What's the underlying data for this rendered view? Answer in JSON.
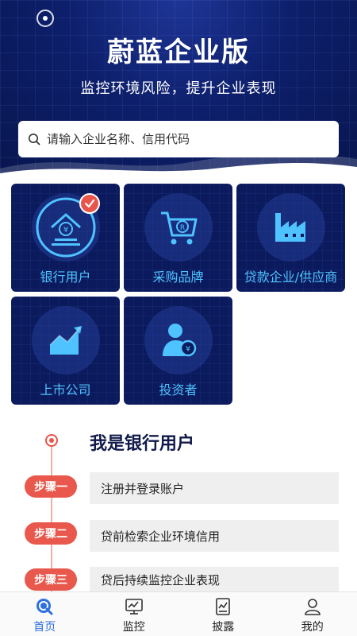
{
  "header": {
    "title": "蔚蓝企业版",
    "subtitle": "监控环境风险，提升企业表现"
  },
  "search": {
    "placeholder": "请输入企业名称、信用代码",
    "icon": "search-icon"
  },
  "categories": [
    {
      "label": "银行用户",
      "icon": "bank-icon",
      "selected": true
    },
    {
      "label": "采购品牌",
      "icon": "shopping-cart-icon",
      "selected": false
    },
    {
      "label": "贷款企业/供应商",
      "icon": "factory-icon",
      "selected": false
    },
    {
      "label": "上市公司",
      "icon": "stock-chart-icon",
      "selected": false
    },
    {
      "label": "投资者",
      "icon": "investor-icon",
      "selected": false
    }
  ],
  "steps": {
    "title": "我是银行用户",
    "items": [
      {
        "badge": "步骤一",
        "text": "注册并登录账户"
      },
      {
        "badge": "步骤二",
        "text": "贷前检索企业环境信用"
      },
      {
        "badge": "步骤三",
        "text": "贷后持续监控企业表现"
      }
    ]
  },
  "tabbar": [
    {
      "label": "首页",
      "icon": "home-search-icon",
      "active": true
    },
    {
      "label": "监控",
      "icon": "monitor-icon",
      "active": false
    },
    {
      "label": "披露",
      "icon": "disclosure-icon",
      "active": false
    },
    {
      "label": "我的",
      "icon": "profile-icon",
      "active": false
    }
  ],
  "colors": {
    "primary_dark": "#0b1a5c",
    "card_label": "#4fc3ff",
    "accent_red": "#e8584c",
    "tab_active": "#2f6fe0"
  }
}
